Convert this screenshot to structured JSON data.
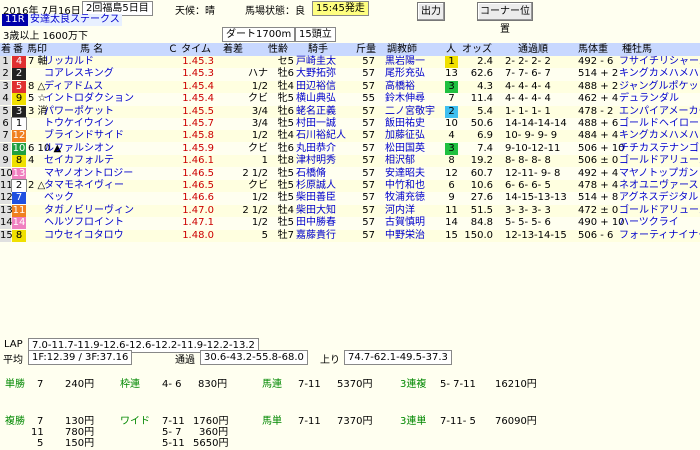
{
  "race": {
    "date": "2016年 7月16日",
    "kai": "2回福島5日目",
    "weather": "天候：晴",
    "track_state": "馬場状態：良",
    "start_time": "15:45発走",
    "race_no": "11R",
    "race_name": "安達太良ステークス",
    "condition": "3歳以上 1600万下",
    "course": "ダート1700m",
    "heads": "15頭立"
  },
  "buttons": {
    "output": "出力",
    "corner": "コーナー位置"
  },
  "headers": {
    "chaku": "着",
    "num": "番",
    "mark": "馬印",
    "name": "馬 名",
    "time": "Ｃ タイム",
    "diff": "着差",
    "sex": "性齢",
    "jockey": "騎手",
    "weight": "斤量",
    "trainer": "調教師",
    "ninki": "人",
    "odds": "オッズ",
    "passing": "通過順",
    "bodyweight": "馬体重",
    "sire": "種牡馬"
  },
  "colors": {
    "waku1": "#ffffff",
    "waku2": "#222222",
    "waku3": "#e03030",
    "waku4": "#2050e0",
    "waku5": "#f0e000",
    "waku6": "#20a040",
    "waku7": "#f08020",
    "waku8": "#f080c0",
    "header_bg": "#c8d8ff",
    "background": "#fffff0",
    "ninki1": "#f0e000",
    "ninki2": "#40c0f0",
    "ninki3": "#20c040"
  },
  "results": [
    {
      "rank": "1",
      "num": "4",
      "waku": "3",
      "mark": "7 軸",
      "name": "リッカルド",
      "time": "1.45.3",
      "diff": "",
      "sex": "セ5",
      "jockey": "戸崎圭太",
      "weight": "57",
      "trainer": "黒岩陽一",
      "ninki": "1",
      "odds": "2.4",
      "passing": "2- 2- 2- 2",
      "bw": "492 - 6",
      "sire": "フサイチリシャール"
    },
    {
      "rank": "2",
      "num": "2",
      "waku": "2",
      "mark": "",
      "name": "コアレスキング",
      "time": "1.45.3",
      "diff": "ハナ",
      "sex": "牡6",
      "jockey": "大野拓弥",
      "weight": "57",
      "trainer": "尾形充弘",
      "ninki": "13",
      "odds": "62.6",
      "passing": "7- 7- 6- 7",
      "bw": "514 + 2",
      "sire": "キングカメハメハ"
    },
    {
      "rank": "3",
      "num": "5",
      "waku": "3",
      "mark": "8 △",
      "name": "ディアドムス",
      "time": "1.45.4",
      "diff": "1/2",
      "sex": "牡4",
      "jockey": "田辺裕信",
      "weight": "57",
      "trainer": "高橋裕",
      "ninki": "3",
      "odds": "4.3",
      "passing": "4- 4- 4- 4",
      "bw": "488 + 2",
      "sire": "ジャングルポケット"
    },
    {
      "rank": "4",
      "num": "9",
      "waku": "5",
      "mark": "5 ☆",
      "name": "イントロダクション",
      "time": "1.45.4",
      "diff": "クビ",
      "sex": "牝5",
      "jockey": "横山典弘",
      "weight": "55",
      "trainer": "鈴木伸尋",
      "ninki": "7",
      "odds": "11.4",
      "passing": "4- 4- 4- 4",
      "bw": "462 + 4",
      "sire": "デュランダル"
    },
    {
      "rank": "5",
      "num": "3",
      "waku": "2",
      "mark": "3 消",
      "name": "パワーポケット",
      "time": "1.45.5",
      "diff": "3/4",
      "sex": "牡6",
      "jockey": "蛯名正義",
      "weight": "57",
      "trainer": "二ノ宮敬宇",
      "ninki": "2",
      "odds": "5.4",
      "passing": "1- 1- 1- 1",
      "bw": "478 - 2",
      "sire": "エンパイアメーカー"
    },
    {
      "rank": "6",
      "num": "1",
      "waku": "1",
      "mark": "",
      "name": "トウケイウイン",
      "time": "1.45.7",
      "diff": "3/4",
      "sex": "牡5",
      "jockey": "村田一誠",
      "weight": "57",
      "trainer": "飯田祐史",
      "ninki": "10",
      "odds": "50.6",
      "passing": "14-14-14-14",
      "bw": "488 + 6",
      "sire": "ゴールドヘイロー"
    },
    {
      "rank": "7",
      "num": "12",
      "waku": "7",
      "mark": "",
      "name": "ブラインドサイド",
      "time": "1.45.8",
      "diff": "1/2",
      "sex": "牡4",
      "jockey": "石川裕紀人",
      "weight": "57",
      "trainer": "加藤征弘",
      "ninki": "4",
      "odds": "6.9",
      "passing": "10- 9- 9- 9",
      "bw": "484 + 4",
      "sire": "キングカメハメハ"
    },
    {
      "rank": "8",
      "num": "10",
      "waku": "6",
      "mark": "6 10 ▲",
      "name": "ルファルシオン",
      "time": "1.45.9",
      "diff": "クビ",
      "sex": "牡6",
      "jockey": "丸田恭介",
      "weight": "57",
      "trainer": "松田国英",
      "ninki": "3",
      "odds": "7.4",
      "passing": "9-10-12-11",
      "bw": "506 + 10",
      "sire": "チチカステナンゴ"
    },
    {
      "rank": "9",
      "num": "8",
      "waku": "5",
      "mark": "4",
      "name": "セイカフォルテ",
      "time": "1.46.1",
      "diff": "1",
      "sex": "牡8",
      "jockey": "津村明秀",
      "weight": "57",
      "trainer": "相沢郁",
      "ninki": "8",
      "odds": "19.2",
      "passing": "8- 8- 8- 8",
      "bw": "506 ± 0",
      "sire": "ゴールドアリュール"
    },
    {
      "rank": "10",
      "num": "13",
      "waku": "8",
      "mark": "",
      "name": "マヤノオントロジー",
      "time": "1.46.5",
      "diff": "2 1/2",
      "sex": "牡5",
      "jockey": "石橋脩",
      "weight": "57",
      "trainer": "安達昭夫",
      "ninki": "12",
      "odds": "60.7",
      "passing": "12-11- 9- 8",
      "bw": "492 + 4",
      "sire": "マヤノトップガン"
    },
    {
      "rank": "11",
      "num": "2",
      "waku": "1",
      "mark": "2 △",
      "name": "タマモネイヴィー",
      "time": "1.46.5",
      "diff": "クビ",
      "sex": "牡5",
      "jockey": "杉原誠人",
      "weight": "57",
      "trainer": "中竹和也",
      "ninki": "6",
      "odds": "10.6",
      "passing": "6- 6- 6- 5",
      "bw": "478 + 4",
      "sire": "ネオユニヴァース"
    },
    {
      "rank": "12",
      "num": "7",
      "waku": "4",
      "mark": "",
      "name": "ベック",
      "time": "1.46.6",
      "diff": "1/2",
      "sex": "牡5",
      "jockey": "柴田善臣",
      "weight": "57",
      "trainer": "牧浦充徳",
      "ninki": "9",
      "odds": "27.6",
      "passing": "14-15-13-13",
      "bw": "514 + 8",
      "sire": "アグネスデジタル"
    },
    {
      "rank": "13",
      "num": "11",
      "waku": "7",
      "mark": "",
      "name": "タガノビリーヴィン",
      "time": "1.47.0",
      "diff": "2 1/2",
      "sex": "牡4",
      "jockey": "柴田大知",
      "weight": "57",
      "trainer": "河内洋",
      "ninki": "11",
      "odds": "51.5",
      "passing": "3- 3- 3- 3",
      "bw": "472 ± 0",
      "sire": "ゴールドアリュール"
    },
    {
      "rank": "14",
      "num": "14",
      "waku": "8",
      "mark": "",
      "name": "ヘルツフロイント",
      "time": "1.47.1",
      "diff": "1/2",
      "sex": "牡5",
      "jockey": "田中勝春",
      "weight": "57",
      "trainer": "古賀慎明",
      "ninki": "14",
      "odds": "84.8",
      "passing": "5- 5- 5- 6",
      "bw": "490 + 10",
      "sire": "ハーツクライ"
    },
    {
      "rank": "15",
      "num": "8",
      "waku": "5",
      "mark": "",
      "name": "コウセイコタロウ",
      "time": "1.48.0",
      "diff": "5",
      "sex": "牡7",
      "jockey": "嘉藤貴行",
      "weight": "57",
      "trainer": "中野栄治",
      "ninki": "15",
      "odds": "150.0",
      "passing": "12-13-14-15",
      "bw": "506 - 6",
      "sire": "フォーティナイナーズ"
    }
  ],
  "lap": {
    "label": "LAP",
    "values": "7.0-11.7-11.9-12.6-12.6-12.2-11.9-12.2-13.2",
    "avg_label": "平均",
    "avg": "1F:12.39 / 3F:37.16",
    "tsuka_label": "通過",
    "tsuka": "30.6-43.2-55.8-68.0",
    "agari_label": "上り",
    "agari": "74.7-62.1-49.5-37.3"
  },
  "payouts": {
    "tansho_label": "単勝",
    "tansho_num": "7",
    "tansho_pay": "240円",
    "wakuren_label": "枠連",
    "wakuren_num": "4- 6",
    "wakuren_pay": "830円",
    "umaren_label": "馬連",
    "umaren_num": "7-11",
    "umaren_pay": "5370円",
    "sanrenpuku_label": "3連複",
    "sanrenpuku_num": "5- 7-11",
    "sanrenpuku_pay": "16210円",
    "fukusho_label": "複勝",
    "fukusho_nums": [
      "7",
      "11",
      "5"
    ],
    "fukusho_pays": [
      "130円",
      "780円",
      "150円"
    ],
    "wide_label": "ワイド",
    "wide_nums": [
      "7-11",
      "5- 7",
      "5-11"
    ],
    "wide_pays": [
      "1760円",
      "360円",
      "5650円"
    ],
    "umatan_label": "馬単",
    "umatan_num": "7-11",
    "umatan_pay": "7370円",
    "sanrentan_label": "3連単",
    "sanrentan_num": "7-11- 5",
    "sanrentan_pay": "76090円"
  }
}
